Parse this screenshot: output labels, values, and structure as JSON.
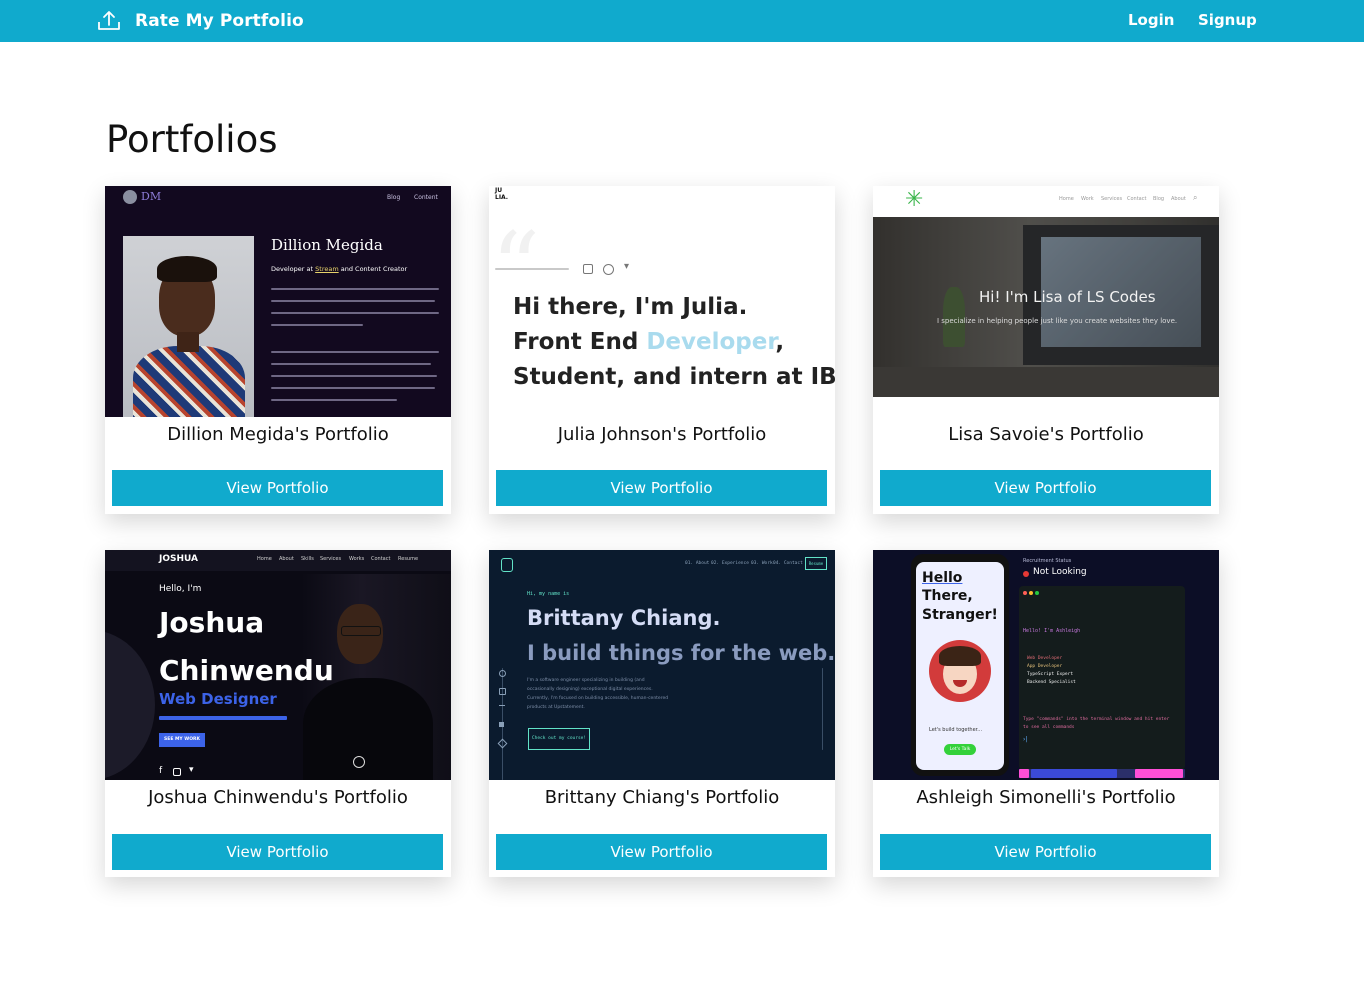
{
  "app": {
    "brand": "Rate My Portfolio",
    "nav": {
      "login": "Login",
      "signup": "Signup"
    },
    "colors": {
      "primary": "#10aacd",
      "text": "#111111"
    },
    "brand_icon": "upload-icon"
  },
  "page": {
    "title": "Portfolios"
  },
  "cards": [
    {
      "title": "Dillion Megida's Portfolio",
      "button": "View Portfolio",
      "preview": {
        "logo": "DM",
        "nav": [
          "Blog",
          "Content"
        ],
        "name": "Dillion Megida",
        "tagline_a": "Developer",
        "tagline_b": "at",
        "tagline_link": "Stream",
        "tagline_c": "and Content Creator"
      }
    },
    {
      "title": "Julia Johnson's Portfolio",
      "button": "View Portfolio",
      "preview": {
        "logo_top": "JU",
        "logo_bottom": "LIA.",
        "line1": "Hi there, I'm Julia.",
        "line2_a": "Front End",
        "line2_b": "Developer",
        "line2_c": ",",
        "line3": "Student, and intern at IBM."
      }
    },
    {
      "title": "Lisa Savoie's Portfolio",
      "button": "View Portfolio",
      "preview": {
        "nav": [
          "Home",
          "Work",
          "Services",
          "Contact",
          "Blog",
          "About"
        ],
        "headline": "Hi! I'm Lisa of LS Codes",
        "sub": "I specialize in helping people just like you create websites they love."
      }
    },
    {
      "title": "Joshua Chinwendu's Portfolio",
      "button": "View Portfolio",
      "preview": {
        "logo": "JOSHUA",
        "nav": [
          "Home",
          "About",
          "Skills",
          "Services",
          "Works",
          "Contact",
          "Resume"
        ],
        "greeting": "Hello, I'm",
        "first": "Joshua",
        "last": "Chinwendu",
        "role": "Web Designer",
        "cta": "SEE MY WORK"
      }
    },
    {
      "title": "Brittany Chiang's Portfolio",
      "button": "View Portfolio",
      "preview": {
        "nav": [
          "01. About",
          "02. Experience",
          "03. Work",
          "04. Contact"
        ],
        "resume": "Resume",
        "intro": "Hi, my name is",
        "name": "Brittany Chiang.",
        "headline": "I build things for the web.",
        "body": "I'm a software engineer specializing in building (and occasionally designing) exceptional digital experiences. Currently, I'm focused on building accessible, human-centered products at Upstatement.",
        "cta": "Check out my course!"
      }
    },
    {
      "title": "Ashleigh Simonelli's Portfolio",
      "button": "View Portfolio",
      "preview": {
        "hello": "Hello",
        "there": "There,",
        "stranger": "Stranger!",
        "phone_caption": "Let's build together...",
        "phone_button": "Let's Talk",
        "status_label": "Recruitment Status",
        "status_value": "Not Looking",
        "terminal_hello": "Hello! I'm Ashleigh",
        "skills": [
          "Web Developer",
          "App Developer",
          "TypeScript Expert",
          "Backend Specialist"
        ],
        "terminal_help": "Type \"commands\" into the terminal window and hit enter to see all commands"
      }
    }
  ]
}
